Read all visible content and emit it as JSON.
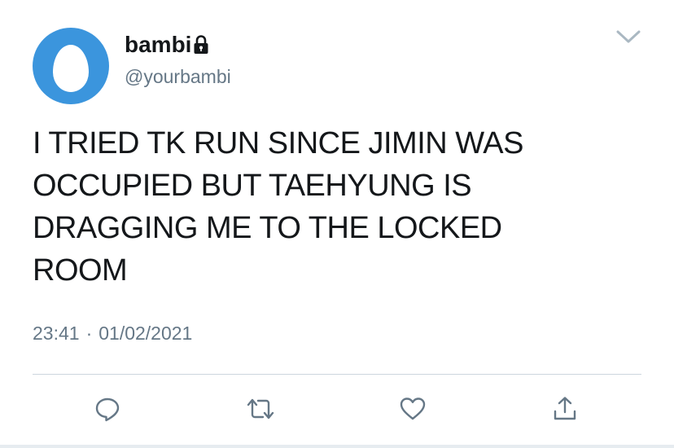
{
  "user": {
    "display_name": "bambi",
    "handle": "@yourbambi",
    "protected_icon": "lock-icon",
    "avatar_icon": "default-egg-avatar"
  },
  "tweet": {
    "text": "I TRIED TK RUN SINCE JIMIN WAS\nOCCUPIED BUT TAEHYUNG IS\nDRAGGING ME TO THE LOCKED\nROOM",
    "time": "23:41",
    "separator": "·",
    "date": "01/02/2021"
  },
  "menu": {
    "icon": "chevron-down-icon"
  },
  "actions": [
    {
      "name": "reply",
      "icon": "reply-icon"
    },
    {
      "name": "retweet",
      "icon": "retweet-icon"
    },
    {
      "name": "like",
      "icon": "heart-icon"
    },
    {
      "name": "share",
      "icon": "share-icon"
    }
  ],
  "colors": {
    "avatar_bg": "#3b95dd",
    "text_primary": "#14171a",
    "text_secondary": "#657786",
    "icon_gray": "#657786",
    "divider": "#ccd6dd"
  }
}
